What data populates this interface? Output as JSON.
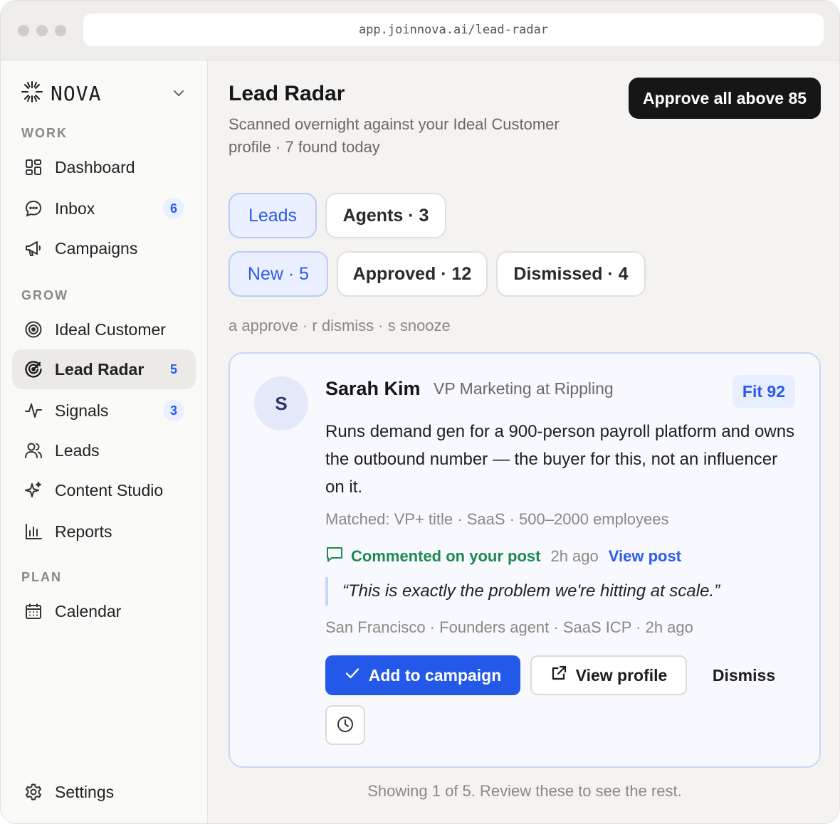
{
  "browser": {
    "url": "app.joinnova.ai/lead-radar"
  },
  "brand": {
    "name": "NOVA"
  },
  "sidebar": {
    "sections": [
      {
        "label": "WORK"
      },
      {
        "label": "GROW"
      },
      {
        "label": "PLAN"
      }
    ],
    "items": [
      {
        "label": "Dashboard",
        "icon": "grid-icon"
      },
      {
        "label": "Inbox",
        "icon": "chat-bubble-icon",
        "badge": "6"
      },
      {
        "label": "Campaigns",
        "icon": "megaphone-icon"
      },
      {
        "label": "Ideal Customer",
        "icon": "target-icon"
      },
      {
        "label": "Lead Radar",
        "icon": "radar-icon",
        "badge": "5",
        "active": true
      },
      {
        "label": "Signals",
        "icon": "pulse-icon",
        "badge": "3"
      },
      {
        "label": "Leads",
        "icon": "users-icon"
      },
      {
        "label": "Content Studio",
        "icon": "sparkle-icon"
      },
      {
        "label": "Reports",
        "icon": "bar-chart-icon"
      },
      {
        "label": "Calendar",
        "icon": "calendar-icon"
      }
    ],
    "settings": {
      "label": "Settings",
      "icon": "gear-icon"
    }
  },
  "header": {
    "title": "Lead Radar",
    "subtitle": "Scanned overnight against your Ideal Customer profile · 7 found today",
    "approve_all_label": "Approve all above 85"
  },
  "tabs": {
    "primary": [
      {
        "label": "Leads",
        "selected": true
      },
      {
        "label": "Agents · 3",
        "selected": false
      }
    ],
    "status": [
      {
        "label": "New · 5",
        "selected": true
      },
      {
        "label": "Approved · 12",
        "selected": false
      },
      {
        "label": "Dismissed · 4",
        "selected": false
      }
    ]
  },
  "shortcuts_hint": "a approve · r dismiss · s snooze",
  "lead_card": {
    "avatar_initial": "S",
    "name": "Sarah Kim",
    "role": "VP Marketing at Rippling",
    "fit": "Fit 92",
    "description": "Runs demand gen for a 900-person payroll platform and owns the outbound number — the buyer for this, not an influencer on it.",
    "matched": "Matched: VP+ title · SaaS · 500–2000 employees",
    "activity": {
      "text": "Commented on your post",
      "time": "2h ago",
      "link": "View post"
    },
    "quote": "“This is exactly the problem we're hitting at scale.”",
    "meta": "San Francisco · Founders agent · SaaS ICP · 2h ago",
    "actions": {
      "add": "Add to campaign",
      "view_profile": "View profile",
      "dismiss": "Dismiss"
    }
  },
  "footer_note": "Showing 1 of 5. Review these to see the rest.",
  "colors": {
    "accent": "#2458e8",
    "success": "#1d8a4e",
    "dark_button": "#161616"
  }
}
